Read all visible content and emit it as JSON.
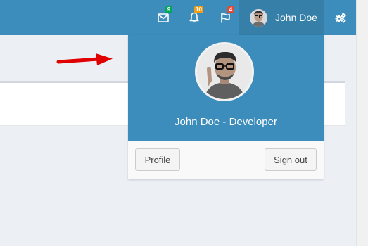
{
  "navbar": {
    "bg_color": "#3c8dbc",
    "messages": {
      "icon": "envelope-icon",
      "badge": "9",
      "badge_color": "#00a65a"
    },
    "notifications": {
      "icon": "bell-icon",
      "badge": "10",
      "badge_color": "#f39c12"
    },
    "tasks": {
      "icon": "flag-icon",
      "badge": "4",
      "badge_color": "#dd4b39"
    },
    "user": {
      "name": "John Doe"
    },
    "settings": {
      "icon": "gears-icon"
    }
  },
  "dropdown": {
    "header_text": "John Doe - Developer",
    "profile_label": "Profile",
    "signout_label": "Sign out"
  },
  "annotation": {
    "arrow_color": "#e00000"
  }
}
